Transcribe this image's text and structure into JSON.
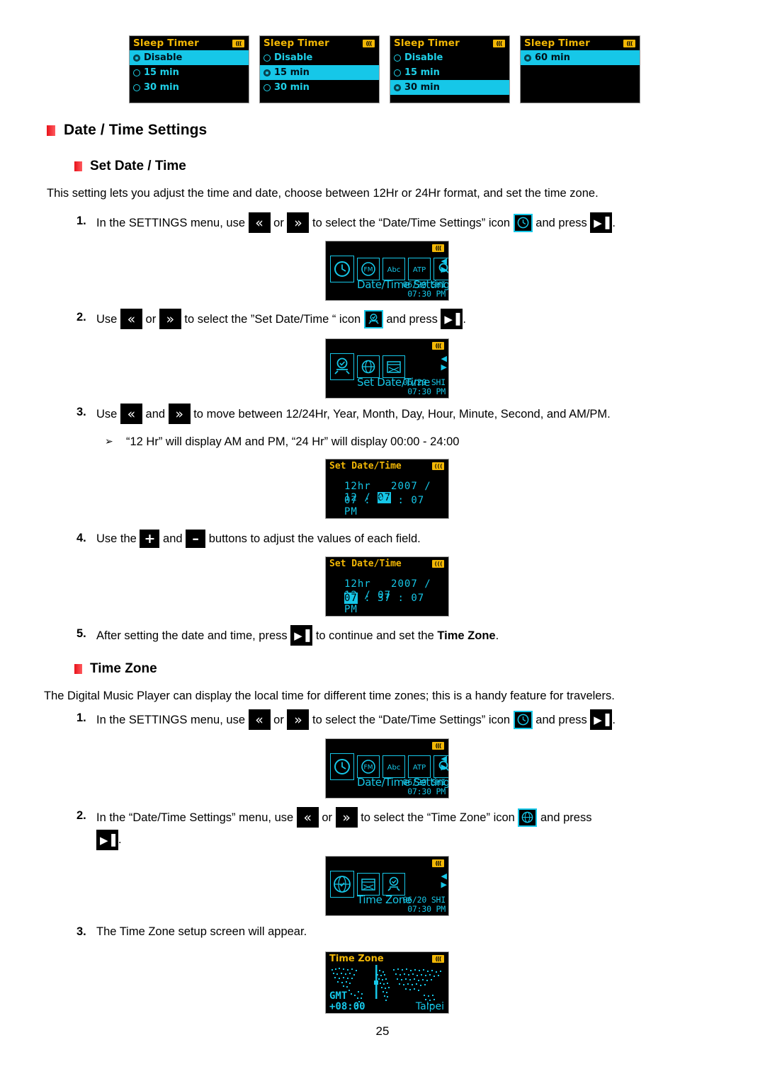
{
  "page_number": "25",
  "sleep_timer_screens": [
    {
      "title": "Sleep Timer",
      "battery_icon": "battery-icon",
      "items": [
        {
          "label": "Disable",
          "selected": true
        },
        {
          "label": "15 min",
          "selected": false
        },
        {
          "label": "30 min",
          "selected": false
        }
      ]
    },
    {
      "title": "Sleep Timer",
      "battery_icon": "battery-icon",
      "items": [
        {
          "label": "Disable",
          "selected": false
        },
        {
          "label": "15 min",
          "selected": true
        },
        {
          "label": "30 min",
          "selected": false
        }
      ]
    },
    {
      "title": "Sleep Timer",
      "battery_icon": "battery-icon",
      "items": [
        {
          "label": "Disable",
          "selected": false
        },
        {
          "label": "15 min",
          "selected": false
        },
        {
          "label": "30 min",
          "selected": true
        }
      ]
    },
    {
      "title": "Sleep Timer",
      "battery_icon": "battery-icon",
      "items": [
        {
          "label": "60 min",
          "selected": true
        }
      ]
    }
  ],
  "headings": {
    "date_time_settings": "Date / Time Settings",
    "set_date_time": "Set Date / Time",
    "time_zone": "Time Zone"
  },
  "intro_set_date_time": "This setting lets you adjust the time and date, choose between 12Hr or 24Hr format, and set the time zone.",
  "intro_time_zone": "The Digital Music Player can display the local time for different time zones; this is a handy feature for travelers.",
  "steps": {
    "sdt1": {
      "num": "1.",
      "t1": "In the SETTINGS menu, use ",
      "t2": " or ",
      "t3": " to select the “Date/Time Settings” icon ",
      "t4": " and press ",
      "t5": "."
    },
    "sdt2": {
      "num": "2.",
      "t1": "Use ",
      "t2": " or ",
      "t3": " to select the ”Set Date/Time “ icon ",
      "t4": " and press ",
      "t5": "."
    },
    "sdt3": {
      "num": "3.",
      "t1": "Use ",
      "t2": " and ",
      "t3": " to move between 12/24Hr, Year, Month, Day, Hour, Minute, Second, and AM/PM.",
      "bullet": "“12 Hr” will display AM and PM, “24 Hr” will display 00:00 - 24:00"
    },
    "sdt4": {
      "num": "4.",
      "t1": "Use the ",
      "t2": " and ",
      "t3": " buttons to adjust the values of each field."
    },
    "sdt5": {
      "num": "5.",
      "t1": "After setting the date and time, press ",
      "t2": " to continue and set the ",
      "t3": "Time Zone",
      "t4": "."
    },
    "tz1": {
      "num": "1.",
      "t1": "In the SETTINGS menu, use ",
      "t2": " or ",
      "t3": " to select the “Date/Time Settings” icon ",
      "t4": " and press ",
      "t5": "."
    },
    "tz2": {
      "num": "2.",
      "t1": "In the “Date/Time Settings” menu, use ",
      "t2": " or ",
      "t3": " to select the “Time Zone” icon ",
      "t4": " and press",
      "t5": "."
    },
    "tz3": {
      "num": "3.",
      "t1": "The Time Zone setup screen will appear."
    }
  },
  "keys": {
    "rewind": "«",
    "forward": "»",
    "play_pause": "▶▐",
    "plus": "+",
    "minus": "–"
  },
  "device_screens": {
    "datetime_settings_menu": {
      "title": "",
      "label": "Date/Time Settings",
      "date": "06/20 SHI",
      "time": "07:30 PM",
      "battery_icon": "battery-icon",
      "icons": [
        "clock-icon",
        "fm-radio-icon",
        "abc-language-icon",
        "atp-icon",
        "search-icon"
      ]
    },
    "set_datetime_menu": {
      "label": "Set Date/Time",
      "date": "06/20 SHI",
      "time": "07:30 PM",
      "battery_icon": "battery-icon",
      "icons": [
        "set-datetime-icon",
        "globe-clock-icon",
        "calendar-icon"
      ]
    },
    "time_zone_menu": {
      "label": "Time Zone",
      "date": "06/20 SHI",
      "time": "07:30 PM",
      "battery_icon": "battery-icon",
      "icons": [
        "time-zone-icon",
        "calendar-icon",
        "set-datetime-icon"
      ]
    },
    "set_datetime_day_selected": {
      "title": "Set Date/Time",
      "battery_icon": "battery-icon",
      "format": "12hr",
      "year": "2007",
      "month": "12",
      "day": "07",
      "hour": "07",
      "minute": "37",
      "second": "07",
      "meridiem": "PM",
      "highlight": "day"
    },
    "set_datetime_hour_selected": {
      "title": "Set Date/Time",
      "battery_icon": "battery-icon",
      "format": "12hr",
      "year": "2007",
      "month": "12",
      "day": "07",
      "hour": "07",
      "minute": "37",
      "second": "07",
      "meridiem": "PM",
      "highlight": "hour"
    },
    "time_zone_map": {
      "title": "Time Zone",
      "battery_icon": "battery-icon",
      "gmt_label": "GMT",
      "offset": "+08:00",
      "city": "Taipei"
    }
  },
  "colors": {
    "screen_cyan": "#16c7e8",
    "screen_amber": "#f2b705",
    "bullet_red": "#e8121a",
    "screen_bg": "#000000"
  }
}
